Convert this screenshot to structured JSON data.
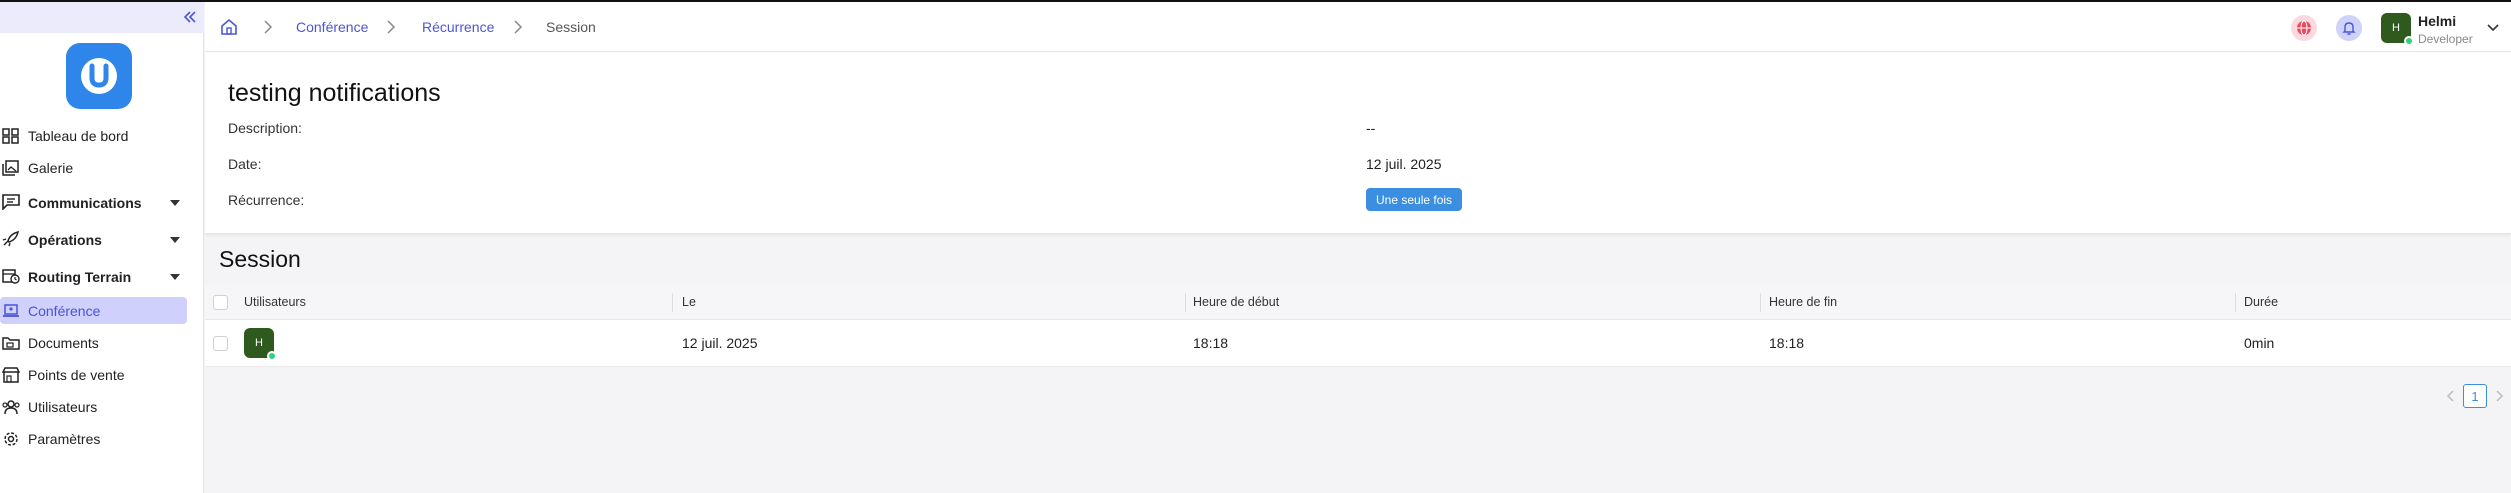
{
  "sidebar": {
    "items": [
      {
        "label": "Tableau de bord",
        "icon": "dashboard-icon"
      },
      {
        "label": "Galerie",
        "icon": "gallery-icon"
      },
      {
        "label": "Communications",
        "icon": "chat-icon"
      },
      {
        "label": "Opérations",
        "icon": "rocket-icon"
      },
      {
        "label": "Routing Terrain",
        "icon": "calendar-route-icon"
      },
      {
        "label": "Conférence",
        "icon": "laptop-icon"
      },
      {
        "label": "Documents",
        "icon": "folder-icon"
      },
      {
        "label": "Points de vente",
        "icon": "store-icon"
      },
      {
        "label": "Utilisateurs",
        "icon": "users-icon"
      },
      {
        "label": "Paramètres",
        "icon": "gear-icon"
      }
    ]
  },
  "breadcrumb": {
    "items": [
      "Conférence",
      "Récurrence",
      "Session"
    ]
  },
  "user": {
    "initial": "H",
    "name": "Helmi",
    "role": "Developer"
  },
  "details": {
    "title": "testing notifications",
    "description_label": "Description:",
    "description_value": "--",
    "date_label": "Date:",
    "date_value": "12 juil. 2025",
    "recurrence_label": "Récurrence:",
    "recurrence_value": "Une seule fois"
  },
  "session": {
    "title": "Session",
    "columns": [
      "Utilisateurs",
      "Le",
      "Heure de début",
      "Heure de fin",
      "Durée"
    ],
    "rows": [
      {
        "user_initial": "H",
        "date": "12 juil. 2025",
        "start": "18:18",
        "end": "18:18",
        "duration": "0min"
      }
    ]
  },
  "pagination": {
    "current_page": "1"
  },
  "colors": {
    "accent": "#4b56d6",
    "active_nav_bg": "#cfd0fb",
    "badge": "#3b8fe0",
    "logo": "#2f86ea",
    "avatar": "#2e5a1e",
    "online": "#2ed37a"
  }
}
